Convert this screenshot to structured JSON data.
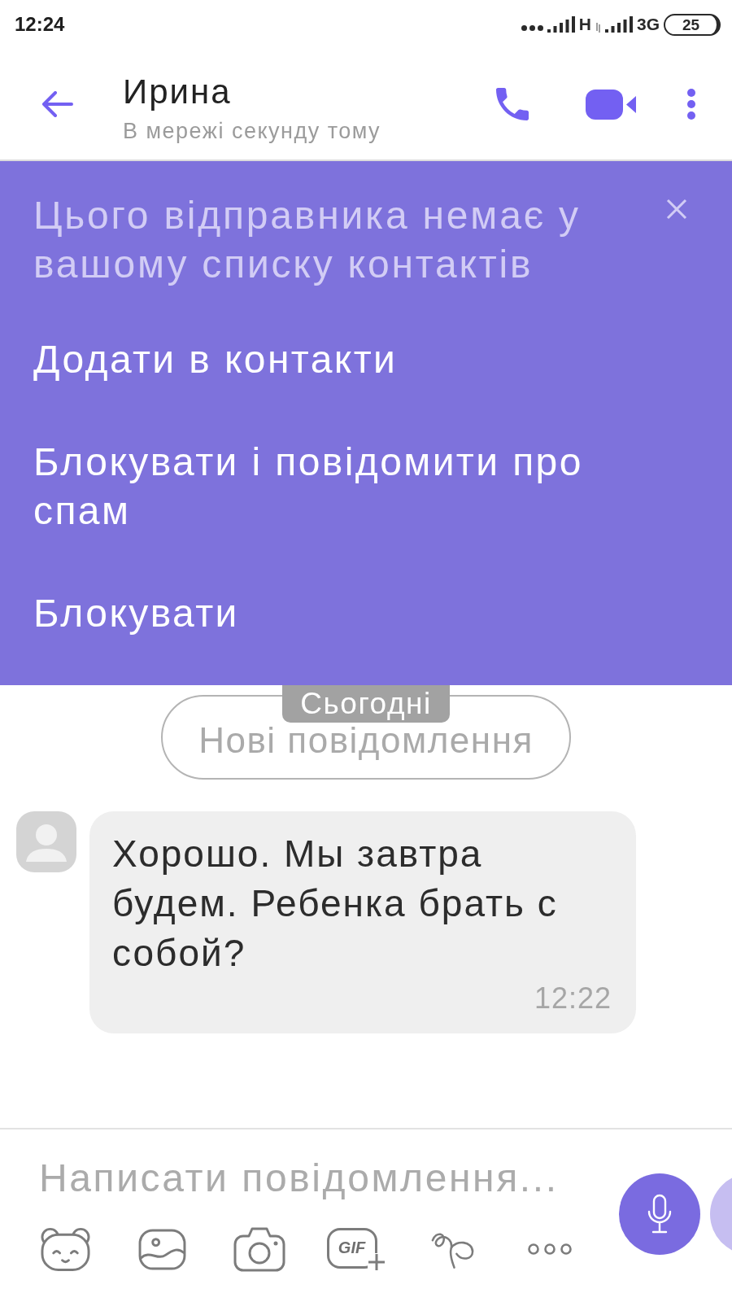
{
  "status_bar": {
    "time": "12:24",
    "network_1": "H",
    "network_2": "3G",
    "battery": "25"
  },
  "header": {
    "title": "Ирина",
    "subtitle": "В мережі секунду тому"
  },
  "contact_banner": {
    "notice": "Цього відправника немає у вашому списку контактів",
    "actions": [
      "Додати в контакти",
      "Блокувати і повідомити про спам",
      "Блокувати"
    ]
  },
  "chat": [
    {
      "kind": "date",
      "label": "Сьогодні"
    },
    {
      "kind": "unread",
      "label": "Нові повідомлення"
    },
    {
      "kind": "incoming",
      "avatar": true,
      "text": "Хорошо. Мы завтра будем. Ребенка брать с собой?",
      "time": "12:22"
    }
  ],
  "composer": {
    "placeholder": "Написати повідомлення...",
    "gif_label": "GIF"
  }
}
